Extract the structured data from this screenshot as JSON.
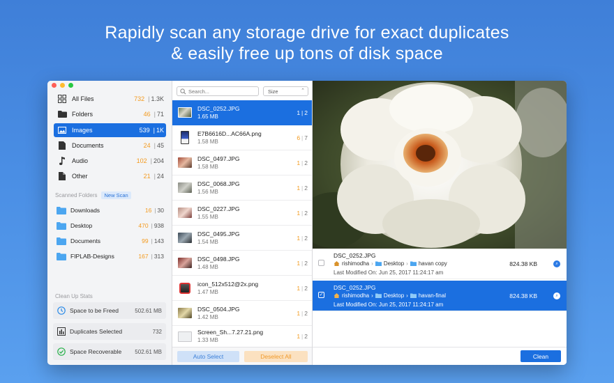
{
  "headline": {
    "line1": "Rapidly scan any storage drive for exact duplicates",
    "line2": "& easily free up tons of disk space"
  },
  "sidebar": {
    "categories": [
      {
        "label": "All Files",
        "count": "732",
        "total": "1.3K",
        "icon": "grid-icon"
      },
      {
        "label": "Folders",
        "count": "46",
        "total": "71",
        "icon": "folder-icon"
      },
      {
        "label": "Images",
        "count": "539",
        "total": "1K",
        "icon": "image-icon",
        "selected": true
      },
      {
        "label": "Documents",
        "count": "24",
        "total": "45",
        "icon": "document-icon"
      },
      {
        "label": "Audio",
        "count": "102",
        "total": "204",
        "icon": "music-note-icon"
      },
      {
        "label": "Other",
        "count": "21",
        "total": "24",
        "icon": "file-icon"
      }
    ],
    "scanned_title": "Scanned Folders",
    "new_scan_label": "New Scan",
    "folders": [
      {
        "label": "Downloads",
        "count": "16",
        "total": "30"
      },
      {
        "label": "Desktop",
        "count": "470",
        "total": "938"
      },
      {
        "label": "Documents",
        "count": "99",
        "total": "143"
      },
      {
        "label": "FIPLAB-Designs",
        "count": "167",
        "total": "313"
      }
    ],
    "stats_title": "Clean Up Stats",
    "stats": [
      {
        "label": "Space to be Freed",
        "value": "502.61 MB",
        "icon": "clock-icon"
      },
      {
        "label": "Duplicates Selected",
        "value": "732",
        "icon": "bar-chart-icon"
      },
      {
        "label": "Space Recoverable",
        "value": "502.61 MB",
        "icon": "checkmark-circle-icon"
      }
    ]
  },
  "filelist": {
    "search_placeholder": "Search...",
    "sort_label": "Size",
    "files": [
      {
        "name": "DSC_0252.JPG",
        "size": "1.65 MB",
        "a": "1",
        "b": "2",
        "selected": true
      },
      {
        "name": "E7B6616D...AC66A.png",
        "size": "1.58 MB",
        "a": "6",
        "b": "7"
      },
      {
        "name": "DSC_0497.JPG",
        "size": "1.58 MB",
        "a": "1",
        "b": "2"
      },
      {
        "name": "DSC_0068.JPG",
        "size": "1.56 MB",
        "a": "1",
        "b": "2"
      },
      {
        "name": "DSC_0227.JPG",
        "size": "1.55 MB",
        "a": "1",
        "b": "2"
      },
      {
        "name": "DSC_0495.JPG",
        "size": "1.54 MB",
        "a": "1",
        "b": "2"
      },
      {
        "name": "DSC_0498.JPG",
        "size": "1.48 MB",
        "a": "1",
        "b": "2"
      },
      {
        "name": "icon_512x512@2x.png",
        "size": "1.47 MB",
        "a": "1",
        "b": "2"
      },
      {
        "name": "DSC_0504.JPG",
        "size": "1.42 MB",
        "a": "1",
        "b": "2"
      },
      {
        "name": "Screen_Sh...7.27.21.png",
        "size": "1.33 MB",
        "a": "1",
        "b": "2"
      }
    ],
    "auto_select_label": "Auto Select",
    "deselect_all_label": "Deselect All"
  },
  "preview": {
    "duplicates": [
      {
        "name": "DSC_0252.JPG",
        "path": [
          "rishimodha",
          "Desktop",
          "havan copy"
        ],
        "modified": "Last Modified On: Jun 25, 2017 11:24:17 am",
        "size": "824.38 KB",
        "checked": false
      },
      {
        "name": "DSC_0252.JPG",
        "path": [
          "rishimodha",
          "Desktop",
          "havan-final"
        ],
        "modified": "Last Modified On: Jun 25, 2017 11:24:17 am",
        "size": "824.38 KB",
        "checked": true
      }
    ],
    "clean_label": "Clean"
  },
  "colors": {
    "accent": "#1b6fe0",
    "count_orange": "#f39a1e",
    "background_blue": "#4a8ee4"
  }
}
